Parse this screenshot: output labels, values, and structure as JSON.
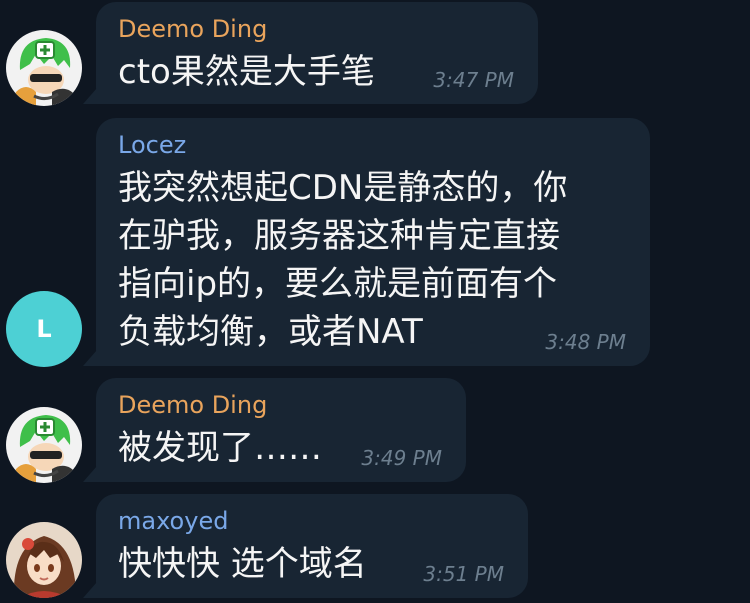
{
  "messages": [
    {
      "sender": "Deemo Ding",
      "sender_color": "#e9a45c",
      "avatar": "green-hair-character-avatar",
      "lines": [
        "cto果然是大手笔"
      ],
      "time": "3:47 PM"
    },
    {
      "sender": "Locez",
      "sender_color": "#7aa8e8",
      "avatar_letter": "L",
      "avatar_color": "#4dd0d4",
      "lines": [
        "我突然想起CDN是静态的，你",
        "在驴我，服务器这种肯定直接",
        "指向ip的，要么就是前面有个",
        "负载均衡，或者NAT"
      ],
      "time": "3:48 PM"
    },
    {
      "sender": "Deemo Ding",
      "sender_color": "#e9a45c",
      "avatar": "green-hair-character-avatar",
      "lines": [
        "被发现了……"
      ],
      "time": "3:49 PM"
    },
    {
      "sender": "maxoyed",
      "sender_color": "#7aa8e8",
      "avatar": "anime-girl-avatar",
      "lines": [
        "快快快 选个域名"
      ],
      "time": "3:51 PM"
    }
  ]
}
